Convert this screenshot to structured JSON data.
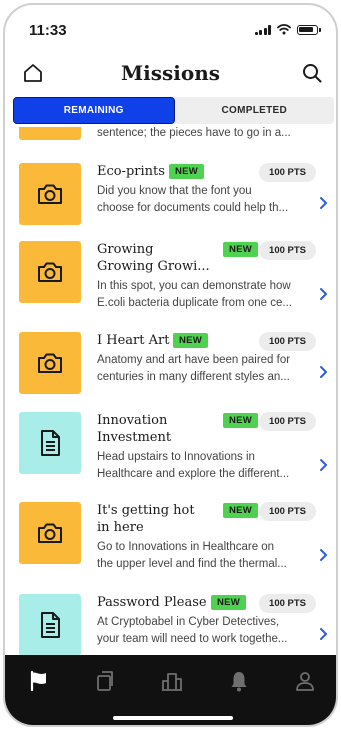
{
  "status_bar": {
    "time": "11:33"
  },
  "header": {
    "title": "Missions"
  },
  "tabs": [
    {
      "label": "REMAINING",
      "active": true
    },
    {
      "label": "COMPLETED",
      "active": false
    }
  ],
  "partial_item": {
    "description": "sentence; the pieces have to go in a..."
  },
  "missions": [
    {
      "title_lines": [
        "Eco-prints"
      ],
      "badge": "NEW",
      "points": "100 PTS",
      "icon": "camera-icon",
      "description_lines": [
        "Did you know that the font you",
        "choose for documents could help th..."
      ]
    },
    {
      "title_lines": [
        "Growing",
        "Growing Growi..."
      ],
      "badge": "NEW",
      "points": "100 PTS",
      "icon": "camera-icon",
      "description_lines": [
        "In this spot, you can demonstrate how",
        "E.coli bacteria duplicate from one ce..."
      ]
    },
    {
      "title_lines": [
        "I Heart Art"
      ],
      "badge": "NEW",
      "points": "100 PTS",
      "icon": "camera-icon",
      "description_lines": [
        "Anatomy and art have been paired for",
        "centuries in many different styles an..."
      ]
    },
    {
      "title_lines": [
        "Innovation",
        "Investment"
      ],
      "badge": "NEW",
      "points": "100 PTS",
      "icon": "document-icon",
      "description_lines": [
        "Head upstairs to Innovations in",
        "Healthcare and explore the different..."
      ]
    },
    {
      "title_lines": [
        "It's getting hot",
        "in here"
      ],
      "badge": "NEW",
      "points": "100 PTS",
      "icon": "camera-icon",
      "description_lines": [
        "Go to Innovations in Healthcare on",
        "the upper level and find the thermal..."
      ]
    },
    {
      "title_lines": [
        "Password Please"
      ],
      "badge": "NEW",
      "points": "100 PTS",
      "icon": "document-icon",
      "description_lines": [
        "At Cryptobabel in Cyber Detectives,",
        "your team will need to work togethe..."
      ]
    }
  ],
  "bottom_nav": [
    {
      "icon": "flag-icon",
      "active": true
    },
    {
      "icon": "cards-icon",
      "active": false
    },
    {
      "icon": "leaderboard-icon",
      "active": false
    },
    {
      "icon": "bell-icon",
      "active": false
    },
    {
      "icon": "profile-icon",
      "active": false
    }
  ],
  "colors": {
    "accent_blue": "#1040e8",
    "badge_green": "#4fd24f",
    "camera_tile": "#fbb93a",
    "document_tile": "#a8ede8",
    "nav_bg": "#111111"
  }
}
